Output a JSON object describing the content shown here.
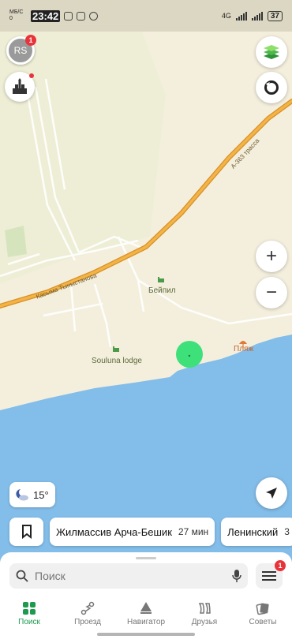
{
  "statusbar": {
    "left_small": "МБ/С 0",
    "time": "23:42",
    "network": "4G",
    "battery": "37"
  },
  "profile": {
    "initials": "RS",
    "badge": "1"
  },
  "map": {
    "labels": {
      "village": "Бейпил",
      "lodge": "Souluna lodge",
      "beach": "Пляж",
      "road_main": "Касыма Тыныстанова",
      "road_highway": "А-363 трасса"
    }
  },
  "controls": {
    "zoom_in": "+",
    "zoom_out": "−"
  },
  "weather": {
    "temperature": "15°"
  },
  "chips": [
    {
      "label": "Жилмассив Арча-Бешик",
      "time": "27 мин"
    },
    {
      "label": "Ленинский",
      "time": "3"
    }
  ],
  "search": {
    "placeholder": "Поиск"
  },
  "menu": {
    "badge": "1"
  },
  "tabs": [
    {
      "label": "Поиск",
      "active": true
    },
    {
      "label": "Проезд",
      "active": false
    },
    {
      "label": "Навигатор",
      "active": false
    },
    {
      "label": "Друзья",
      "active": false
    },
    {
      "label": "Советы",
      "active": false
    }
  ],
  "colors": {
    "accent": "#1e9a4e",
    "water": "#83bde9",
    "land": "#f3eedc",
    "road": "#e8a33a",
    "location_dot": "#3ee07a"
  }
}
